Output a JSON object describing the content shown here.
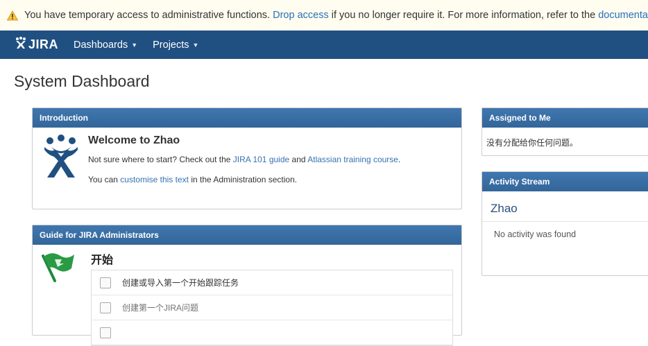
{
  "banner": {
    "prefix": "You have temporary access to administrative functions.",
    "drop_link": "Drop access",
    "middle": "if you no longer require it. For more information, refer to the",
    "doc_link": "documentation"
  },
  "header": {
    "logo_text": "JIRA",
    "nav": [
      {
        "label": "Dashboards"
      },
      {
        "label": "Projects"
      }
    ],
    "color": "#205081"
  },
  "page": {
    "title": "System Dashboard"
  },
  "intro": {
    "heading": "Introduction",
    "welcome": "Welcome to Zhao",
    "p1_prefix": "Not sure where to start? Check out the",
    "p1_link1": "JIRA 101 guide",
    "p1_and": "and",
    "p1_link2": "Atlassian training course",
    "p1_suffix": ".",
    "p2_prefix": "You can",
    "p2_link": "customise this text",
    "p2_suffix": "in the Administration section."
  },
  "guide": {
    "heading": "Guide for JIRA Administrators",
    "title": "开始",
    "tasks": [
      {
        "label": "创建或导入第一个开始跟踪任务",
        "checked": false
      },
      {
        "label": "创建第一个JIRA问题",
        "checked": false
      }
    ]
  },
  "assigned": {
    "heading": "Assigned to Me",
    "message": "没有分配给你任何问题。"
  },
  "activity": {
    "heading": "Activity Stream",
    "name": "Zhao",
    "empty": "No activity was found"
  },
  "icons": {
    "warning": "warning-icon",
    "logo": "jira-logo-icon",
    "intro": "jira-people-icon",
    "guide": "green-flag-icon"
  }
}
